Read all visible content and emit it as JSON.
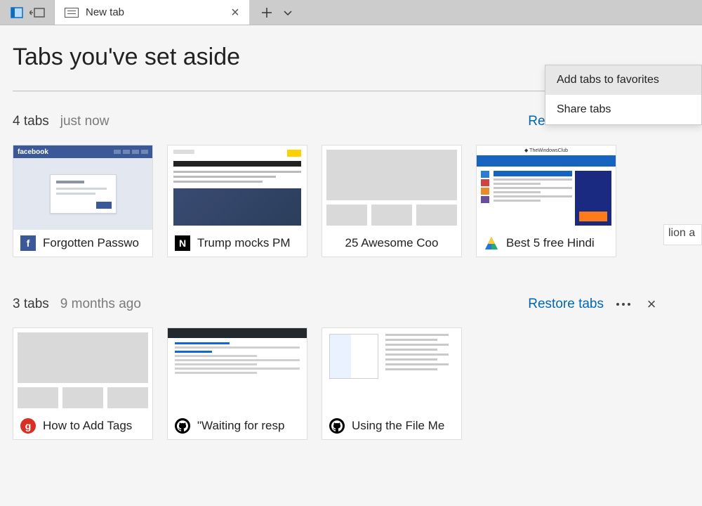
{
  "tabstrip": {
    "current_tab_label": "New tab"
  },
  "panel": {
    "title": "Tabs you've set aside"
  },
  "groups": [
    {
      "count_label": "4 tabs",
      "time_label": "just now",
      "restore_label": "Restore tabs",
      "items": [
        {
          "title": "Forgotten Passwo",
          "icon": "facebook"
        },
        {
          "title": "Trump mocks PM",
          "icon": "news"
        },
        {
          "title": "25 Awesome Coo",
          "icon": "none"
        },
        {
          "title": "Best 5 free Hindi",
          "icon": "windowsclub"
        }
      ]
    },
    {
      "count_label": "3 tabs",
      "time_label": "9 months ago",
      "restore_label": "Restore tabs",
      "items": [
        {
          "title": "How to Add Tags",
          "icon": "gplus"
        },
        {
          "title": "\"Waiting for resp",
          "icon": "github"
        },
        {
          "title": "Using the File Me",
          "icon": "github"
        }
      ]
    }
  ],
  "context_menu": {
    "item1": "Add tabs to favorites",
    "item2": "Share tabs"
  },
  "side_fragment": "lion  a"
}
